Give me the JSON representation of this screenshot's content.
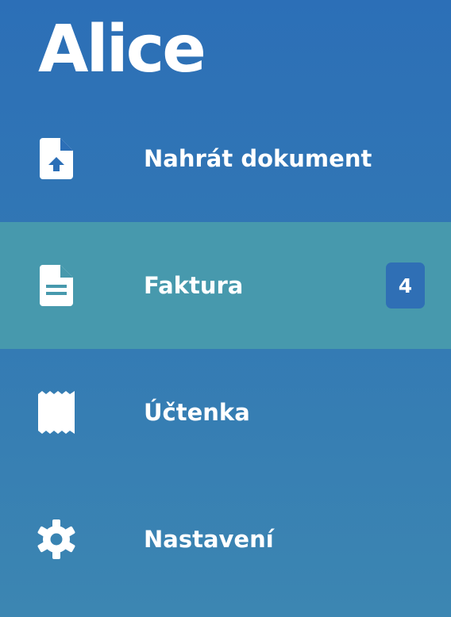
{
  "app": {
    "logo": "Alice"
  },
  "menu": {
    "items": [
      {
        "label": "Nahrát dokument",
        "icon": "upload-file-icon"
      },
      {
        "label": "Faktura",
        "icon": "document-icon",
        "badge": "4",
        "active": true
      },
      {
        "label": "Účtenka",
        "icon": "receipt-icon"
      },
      {
        "label": "Nastavení",
        "icon": "gear-icon"
      }
    ]
  },
  "colors": {
    "sidebar_bg": "#2c6fb7",
    "active_item_bg": "#4799ad",
    "badge_bg": "#2f6fb5",
    "text": "#ffffff"
  }
}
